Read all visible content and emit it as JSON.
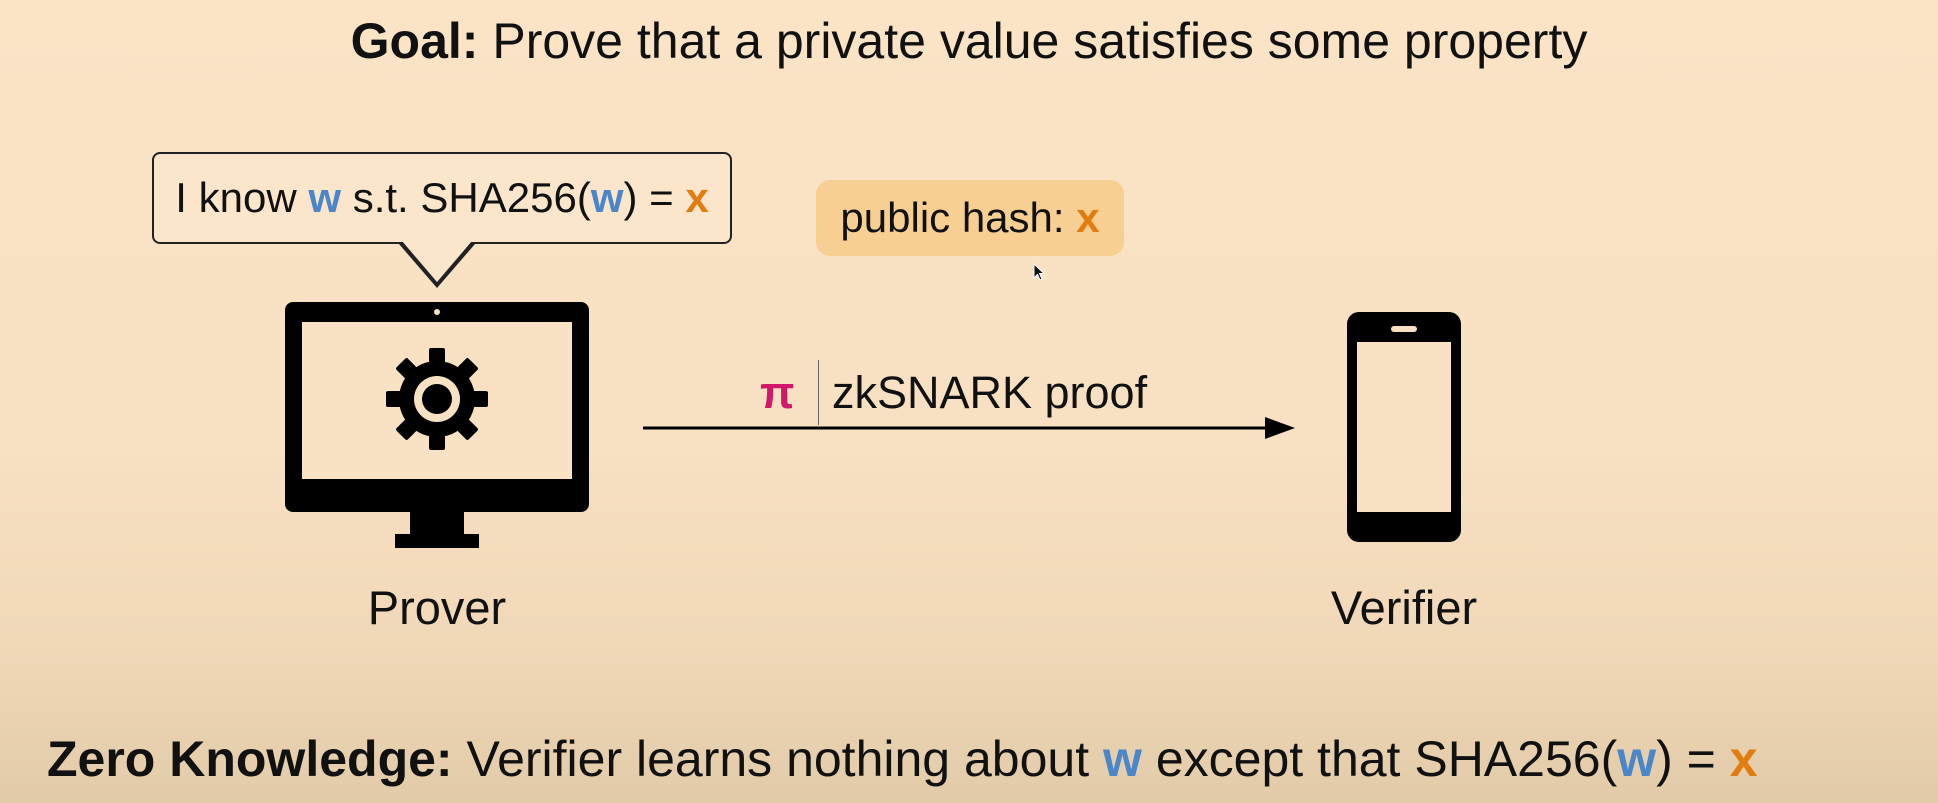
{
  "title": {
    "bold": "Goal:",
    "rest": "Prove that a private value satisfies some property"
  },
  "bubble": {
    "pre": "I know",
    "w": "w",
    "mid": "s.t. SHA256(",
    "w2": "w",
    "post": ") =",
    "x": "x"
  },
  "public_hash": {
    "label": "public hash:",
    "x": "x"
  },
  "proof": {
    "symbol": "π",
    "label": "zkSNARK proof"
  },
  "prover": {
    "label": "Prover"
  },
  "verifier": {
    "label": "Verifier"
  },
  "zero_knowledge": {
    "bold": "Zero Knowledge:",
    "pre": "Verifier learns nothing about",
    "w": "w",
    "mid": "except that SHA256(",
    "w2": "w",
    "post": ") =",
    "x": "x"
  },
  "colors": {
    "background": "#fbe3c6",
    "w": "#4a86c8",
    "x": "#e07c10",
    "pi": "#d0186b",
    "public_hash_box": "#f8cf92"
  },
  "icons": [
    "gear-icon",
    "computer-monitor-icon",
    "smartphone-icon",
    "mouse-pointer-icon",
    "arrow-icon"
  ]
}
